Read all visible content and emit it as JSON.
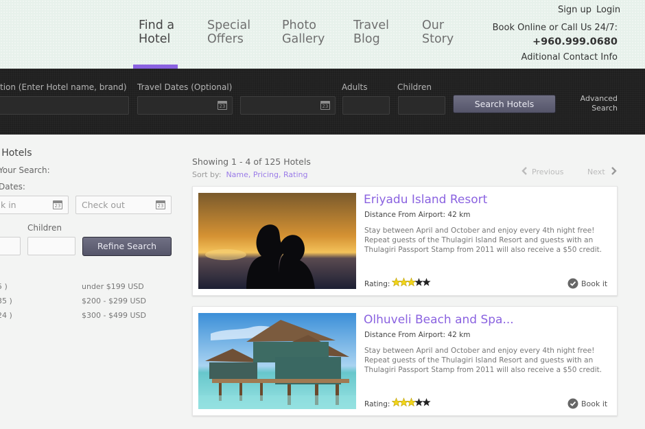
{
  "header": {
    "nav": [
      {
        "label": "Find a\nHotel"
      },
      {
        "label": "Special\nOffers"
      },
      {
        "label": "Photo\nGallery"
      },
      {
        "label": "Travel\nBlog"
      },
      {
        "label": "Our\nStory"
      }
    ],
    "signup": "Sign up",
    "login": "Login",
    "book_online": "Book Online or Call Us 24/7:",
    "phone": "+960.999.0680",
    "contact_info": "Aditional Contact Info",
    "accent": "#8a62e0"
  },
  "searchbar": {
    "destination_label": "tion (Enter Hotel name, brand)",
    "dates_label": "Travel Dates (Optional)",
    "adults_label": "Adults",
    "children_label": "Children",
    "search_button": "Search Hotels",
    "advanced": "Advanced\nSearch",
    "calendar_day": "23"
  },
  "sidebar": {
    "title": "r Hotels",
    "your_search": "Your Search:",
    "dates": "Dates:",
    "checkin_placeholder": "k in",
    "checkout_placeholder": "Check out",
    "children_label": "Children",
    "refine_button": "Refine Search",
    "prices": [
      {
        "count": "5 )",
        "range": "under $199 USD"
      },
      {
        "count": "35 )",
        "range": "$200 - $299 USD"
      },
      {
        "count": "24 )",
        "range": "$300 - $499 USD"
      }
    ]
  },
  "results": {
    "showing": "Showing 1 - 4 of 125 Hotels",
    "sort_by": "Sort by:",
    "sort_name": "Name,",
    "sort_pricing": "Pricing,",
    "sort_rating": "Rating",
    "previous": "Previous",
    "next": "Next",
    "hotels": [
      {
        "name": "Eriyadu Island Resort",
        "distance": "Distance From Airport: 42 km",
        "description": "Stay between April and October and enjoy every 4th night free! Repeat guests of the Thulagiri Island Resort and guests with an Thulagiri Passport Stamp from 2011 will also receive a $50 credit.",
        "rating_label": "Rating:",
        "rating": 3,
        "rating_max": 5,
        "book_label": "Book it"
      },
      {
        "name": "Olhuveli Beach and Spa...",
        "distance": "Distance From Airport: 42 km",
        "description": "Stay between April and October and enjoy every 4th night free! Repeat guests of the Thulagiri Island Resort and guests with an Thulagiri Passport Stamp from 2011 will also receive a $50 credit.",
        "rating_label": "Rating:",
        "rating": 3,
        "rating_max": 5,
        "book_label": "Book it"
      }
    ]
  }
}
